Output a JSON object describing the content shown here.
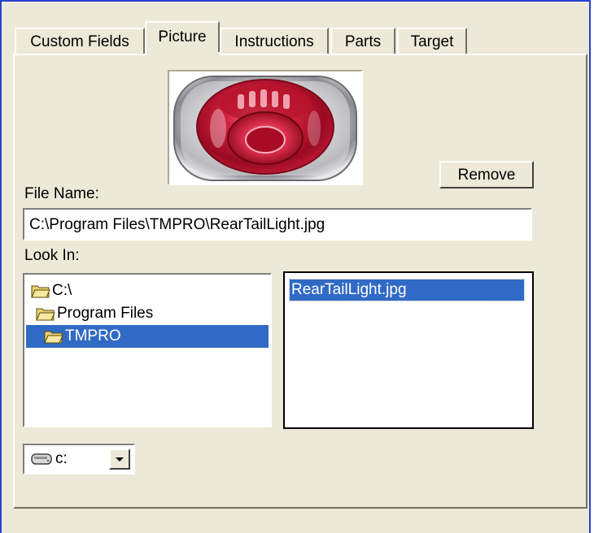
{
  "tabs": [
    {
      "label": "Custom Fields"
    },
    {
      "label": "Picture"
    },
    {
      "label": "Instructions"
    },
    {
      "label": "Parts"
    },
    {
      "label": "Target"
    }
  ],
  "picture_tab": {
    "remove_label": "Remove",
    "file_name_label": "File Name:",
    "file_name_value": "C:\\Program Files\\TMPRO\\RearTailLight.jpg",
    "look_in_label": "Look In:",
    "folders": [
      {
        "label": "C:\\"
      },
      {
        "label": "Program Files"
      },
      {
        "label": "TMPRO"
      }
    ],
    "files": [
      {
        "label": "RearTailLight.jpg"
      }
    ],
    "drive": {
      "label": "c:"
    }
  },
  "colors": {
    "selection": "#316ac5",
    "window_border": "#2840d0",
    "face": "#ece9d8"
  },
  "icons": {
    "folder": "folder-icon",
    "open_folder": "open-folder-icon",
    "drive": "drive-icon",
    "dropdown": "chevron-down-icon"
  }
}
